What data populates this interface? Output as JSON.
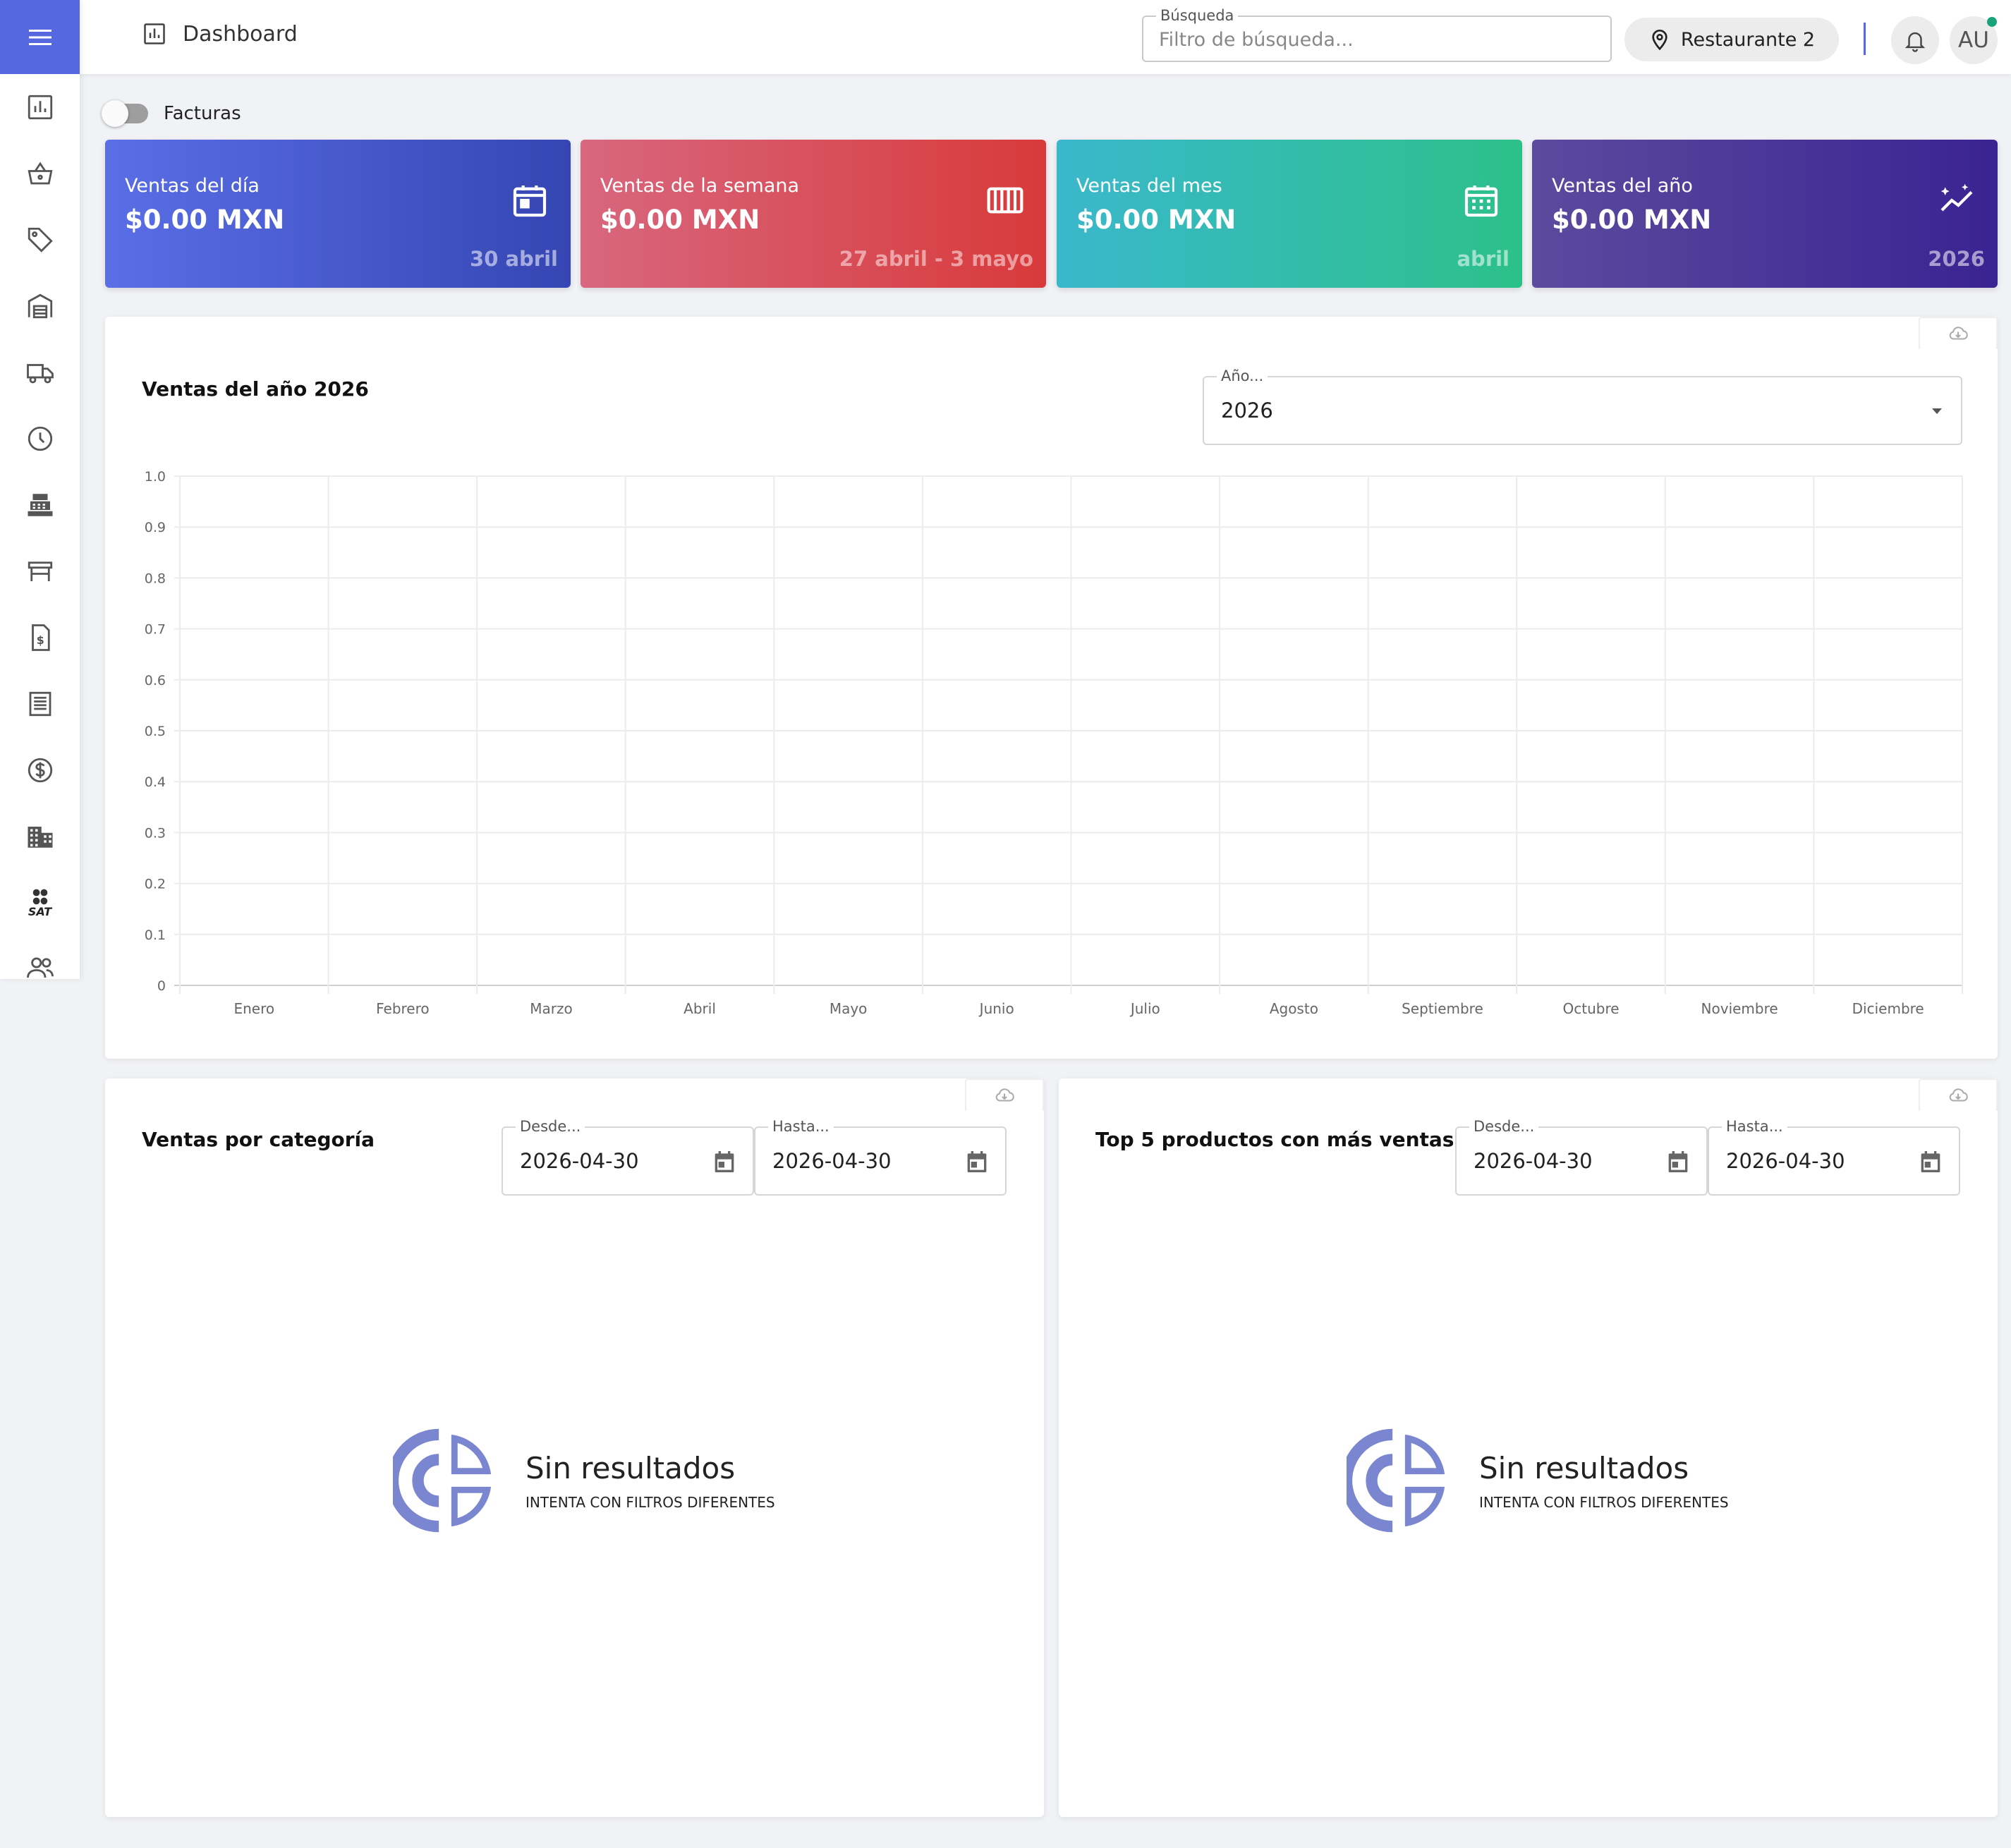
{
  "header": {
    "title": "Dashboard",
    "search_legend": "Búsqueda",
    "search_placeholder": "Filtro de búsqueda...",
    "location": "Restaurante 2",
    "avatar_initials": "AU"
  },
  "toggle": {
    "label": "Facturas"
  },
  "cards": [
    {
      "label": "Ventas del día",
      "value": "$0.00 MXN",
      "sub": "30 abril"
    },
    {
      "label": "Ventas de la semana",
      "value": "$0.00 MXN",
      "sub": "27 abril - 3 mayo"
    },
    {
      "label": "Ventas del mes",
      "value": "$0.00 MXN",
      "sub": "abril"
    },
    {
      "label": "Ventas del año",
      "value": "$0.00 MXN",
      "sub": "2026"
    }
  ],
  "year_panel": {
    "title": "Ventas del año 2026",
    "select_legend": "Año...",
    "select_value": "2026"
  },
  "chart_data": {
    "type": "bar",
    "title": "Ventas del año 2026",
    "categories": [
      "Enero",
      "Febrero",
      "Marzo",
      "Abril",
      "Mayo",
      "Junio",
      "Julio",
      "Agosto",
      "Septiembre",
      "Octubre",
      "Noviembre",
      "Diciembre"
    ],
    "values": [
      0,
      0,
      0,
      0,
      0,
      0,
      0,
      0,
      0,
      0,
      0,
      0
    ],
    "yticks": [
      "0",
      "0.1",
      "0.2",
      "0.3",
      "0.4",
      "0.5",
      "0.6",
      "0.7",
      "0.8",
      "0.9",
      "1.0"
    ],
    "ylim": [
      0,
      1
    ],
    "grid": true
  },
  "category_panel": {
    "title": "Ventas por categoría",
    "from_legend": "Desde...",
    "from_value": "2026-04-30",
    "to_legend": "Hasta...",
    "to_value": "2026-04-30",
    "empty_title": "Sin resultados",
    "empty_sub": "INTENTA CON FILTROS DIFERENTES"
  },
  "top_panel": {
    "title": "Top 5 productos con más ventas",
    "from_legend": "Desde...",
    "from_value": "2026-04-30",
    "to_legend": "Hasta...",
    "to_value": "2026-04-30",
    "empty_title": "Sin resultados",
    "empty_sub": "INTENTA CON FILTROS DIFERENTES"
  },
  "sidebar": {
    "icons": [
      "chart-icon",
      "basket-icon",
      "tag-icon",
      "warehouse-icon",
      "truck-icon",
      "clock-icon",
      "cash-register-icon",
      "table-icon",
      "invoice-icon",
      "receipt-icon",
      "dollar-icon",
      "building-icon",
      "sat-icon",
      "users-icon"
    ],
    "sat_label": "SAT"
  },
  "colors": {
    "accent": "#5668e0",
    "empty_logo": "#7b86d0",
    "status_dot": "#1aa37a"
  }
}
